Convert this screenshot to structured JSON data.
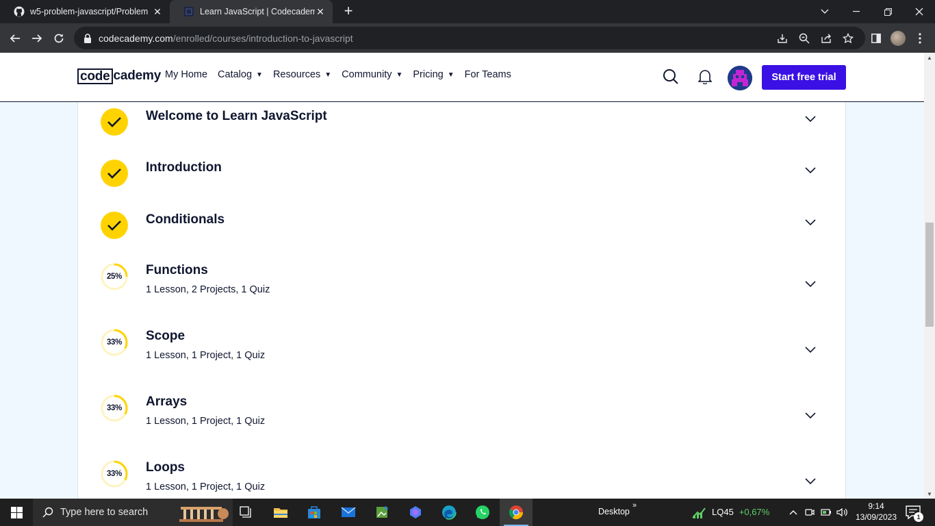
{
  "browser": {
    "tabs": [
      {
        "title": "w5-problem-javascript/Problem",
        "icon": "github-icon",
        "active": false
      },
      {
        "title": "Learn JavaScript | Codecademy",
        "icon": "codecademy-icon",
        "active": true
      }
    ],
    "url": {
      "host": "codecademy.com",
      "path": "/enrolled/courses/introduction-to-javascript"
    }
  },
  "site": {
    "logo": {
      "box": "code",
      "rest": "cademy"
    },
    "nav": [
      {
        "label": "My Home",
        "dropdown": false
      },
      {
        "label": "Catalog",
        "dropdown": true
      },
      {
        "label": "Resources",
        "dropdown": true
      },
      {
        "label": "Community",
        "dropdown": true
      },
      {
        "label": "Pricing",
        "dropdown": true
      },
      {
        "label": "For Teams",
        "dropdown": false
      }
    ],
    "cta_label": "Start free trial"
  },
  "modules": [
    {
      "title": "Welcome to Learn JavaScript",
      "status": "complete"
    },
    {
      "title": "Introduction",
      "status": "complete"
    },
    {
      "title": "Conditionals",
      "status": "complete"
    },
    {
      "title": "Functions",
      "status": "in-progress",
      "progress": 25,
      "progress_label": "25%",
      "summary": "1 Lesson, 2 Projects, 1 Quiz"
    },
    {
      "title": "Scope",
      "status": "in-progress",
      "progress": 33,
      "progress_label": "33%",
      "summary": "1 Lesson, 1 Project, 1 Quiz"
    },
    {
      "title": "Arrays",
      "status": "in-progress",
      "progress": 33,
      "progress_label": "33%",
      "summary": "1 Lesson, 1 Project, 1 Quiz"
    },
    {
      "title": "Loops",
      "status": "in-progress",
      "progress": 33,
      "progress_label": "33%",
      "summary": "1 Lesson, 1 Project, 1 Quiz"
    }
  ],
  "colors": {
    "brand_yellow": "#ffd300",
    "brand_blue": "#3a10e5",
    "navy": "#10162f",
    "page_bg": "#f0f8ff"
  },
  "taskbar": {
    "search_placeholder": "Type here to search",
    "desktop_label": "Desktop",
    "desktop_chevron": "»",
    "stock": {
      "name": "LQ45",
      "change": "+0,67%"
    },
    "time": "9:14",
    "date": "13/09/2023",
    "notifications": "1"
  }
}
